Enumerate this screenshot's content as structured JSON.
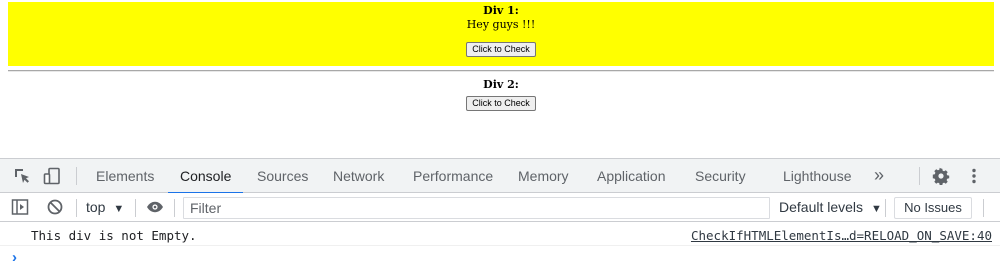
{
  "page": {
    "div1": {
      "title": "Div 1:",
      "text": "Hey guys !!!",
      "button_label": "Click to Check"
    },
    "div2": {
      "title": "Div 2:",
      "button_label": "Click to Check"
    },
    "div1_background": "#ffff00"
  },
  "devtools": {
    "tabs": [
      {
        "label": "Elements"
      },
      {
        "label": "Console",
        "active": true
      },
      {
        "label": "Sources"
      },
      {
        "label": "Network"
      },
      {
        "label": "Performance"
      },
      {
        "label": "Memory"
      },
      {
        "label": "Application"
      },
      {
        "label": "Security"
      },
      {
        "label": "Lighthouse"
      }
    ],
    "more_tabs_glyph": "»",
    "toolbar": {
      "context": "top",
      "filter_placeholder": "Filter",
      "levels_label": "Default levels",
      "issues_label": "No Issues"
    },
    "console": {
      "messages": [
        {
          "text": "This div is not Empty.",
          "source": "CheckIfHTMLElementIs…d=RELOAD_ON_SAVE:40"
        }
      ],
      "prompt_glyph": "›"
    },
    "accent_color": "#1a73e8"
  }
}
